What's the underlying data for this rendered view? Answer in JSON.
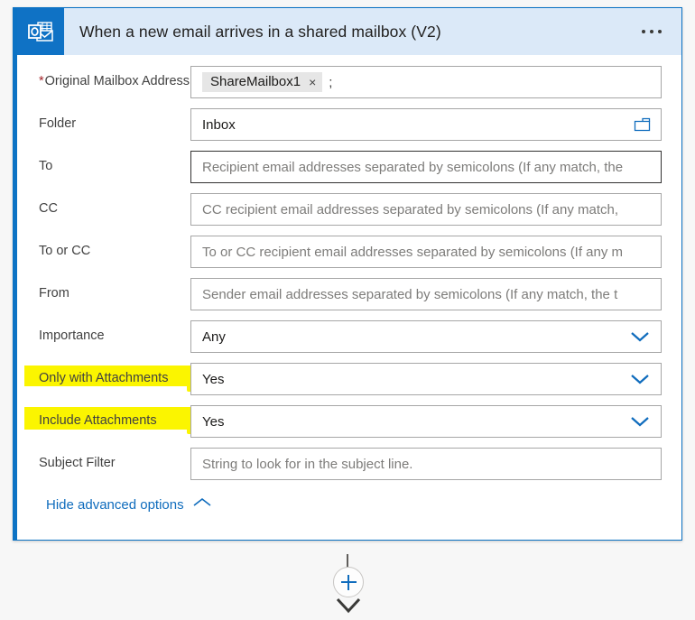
{
  "card": {
    "title": "When a new email arrives in a shared mailbox (V2)",
    "app_icon": "outlook-icon",
    "overflow_menu_label": "...",
    "accent_color": "#0b72c4",
    "header_bg": "#dbe9f8",
    "highlight_color": "#fbf500"
  },
  "fields": [
    {
      "label": "Original Mailbox Address",
      "required": true,
      "type": "token",
      "token": "ShareMailbox1",
      "token_remove": "×",
      "separator": ";",
      "highlighted": false
    },
    {
      "label": "Folder",
      "required": false,
      "type": "picker",
      "value": "Inbox",
      "icon": "folder-icon",
      "highlighted": false
    },
    {
      "label": "To",
      "required": false,
      "type": "text",
      "placeholder": "Recipient email addresses separated by semicolons (If any match, the",
      "focused": true,
      "highlighted": false
    },
    {
      "label": "CC",
      "required": false,
      "type": "text",
      "placeholder": "CC recipient email addresses separated by semicolons (If any match,",
      "highlighted": false
    },
    {
      "label": "To or CC",
      "required": false,
      "type": "text",
      "placeholder": "To or CC recipient email addresses separated by semicolons (If any m",
      "highlighted": false
    },
    {
      "label": "From",
      "required": false,
      "type": "text",
      "placeholder": "Sender email addresses separated by semicolons (If any match, the t",
      "highlighted": false
    },
    {
      "label": "Importance",
      "required": false,
      "type": "dropdown",
      "value": "Any",
      "icon": "chevron-down-icon",
      "highlighted": false
    },
    {
      "label": "Only with Attachments",
      "required": false,
      "type": "dropdown",
      "value": "Yes",
      "icon": "chevron-down-icon",
      "highlighted": true
    },
    {
      "label": "Include Attachments",
      "required": false,
      "type": "dropdown",
      "value": "Yes",
      "icon": "chevron-down-icon",
      "highlighted": true
    },
    {
      "label": "Subject Filter",
      "required": false,
      "type": "text",
      "placeholder": "String to look for in the subject line.",
      "highlighted": false
    }
  ],
  "footer": {
    "advanced_toggle_label": "Hide advanced options",
    "advanced_toggle_icon": "chevron-up-icon"
  },
  "connector": {
    "add_step_icon": "plus-icon",
    "arrow_icon": "arrow-down-icon"
  }
}
